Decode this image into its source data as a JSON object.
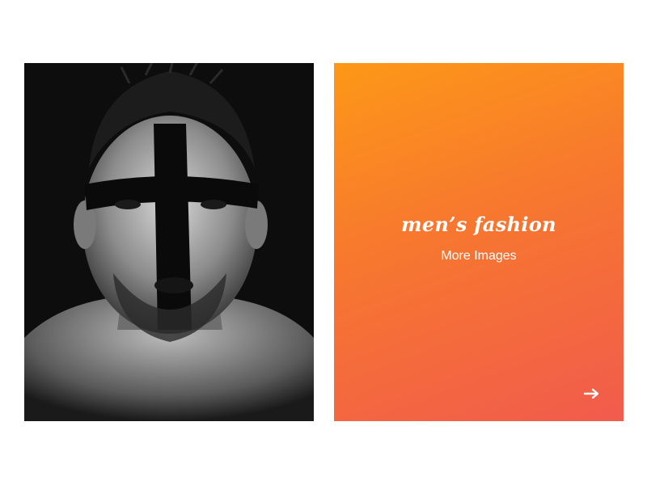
{
  "photo": {
    "subject": "black-and-white portrait with painted cross"
  },
  "promo": {
    "title": "men’s fashion",
    "subtitle": "More Images",
    "gradient_start": "#fd9817",
    "gradient_end": "#f15b4d",
    "arrow_icon": "arrow-right-icon"
  }
}
